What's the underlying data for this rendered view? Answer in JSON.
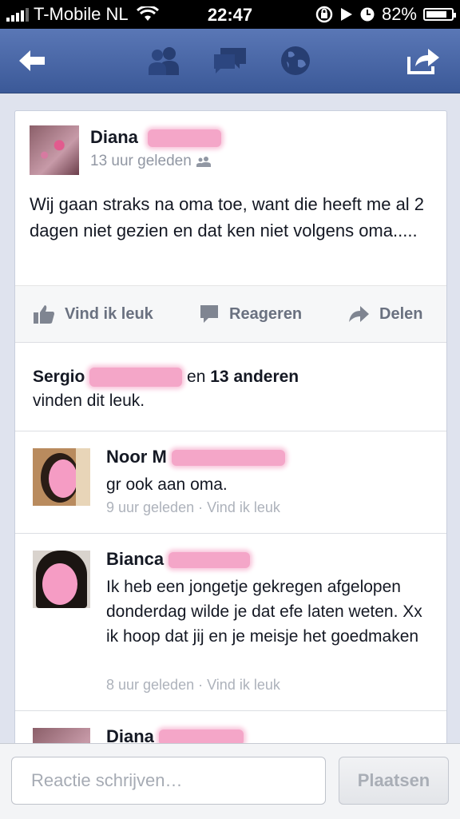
{
  "status_bar": {
    "carrier": "T-Mobile NL",
    "time": "22:47",
    "battery_percent": "82%",
    "battery_level": 0.82
  },
  "navbar": {
    "icons": [
      "back-arrow-icon",
      "friends-icon",
      "messages-icon",
      "globe-icon",
      "share-icon"
    ],
    "color": "#3b5998"
  },
  "post": {
    "author": "Diana",
    "time": "13 uur geleden",
    "text": "Wij gaan straks na oma toe, want die heeft me al 2 dagen niet gezien en dat ken niet volgens oma.....",
    "actions": {
      "like": "Vind ik leuk",
      "comment": "Reageren",
      "share": "Delen"
    },
    "likes": {
      "first_name": "Sergio",
      "connector": "en",
      "others": "13 anderen",
      "suffix": "vinden dit leuk."
    }
  },
  "comments": [
    {
      "name": "Noor",
      "name_suffix": "M",
      "text": "gr ook aan oma.",
      "time": "9 uur geleden",
      "like_link": "Vind ik leuk"
    },
    {
      "name": "Bianca",
      "name_suffix": "",
      "text": "Ik heb een jongetje gekregen afgelopen donderdag wilde je dat efe laten weten. Xx ik hoop dat jij en je meisje het goedmaken",
      "time": "8 uur geleden",
      "like_link": "Vind ik leuk"
    },
    {
      "name": "Diana"
    }
  ],
  "meta_separator": "·",
  "composer": {
    "placeholder": "Reactie schrijven…",
    "button_label": "Plaatsen"
  }
}
